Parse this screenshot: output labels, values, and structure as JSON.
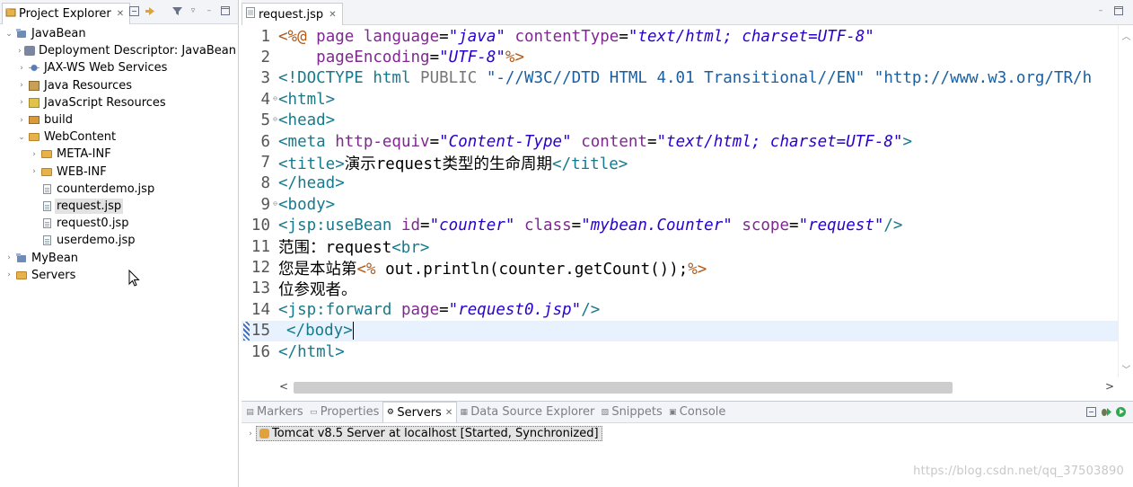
{
  "explorer": {
    "title": "Project Explorer",
    "tree": [
      {
        "label": "JavaBean",
        "depth": 0,
        "twist": "open",
        "icon": "project-icon"
      },
      {
        "label": "Deployment Descriptor: JavaBean",
        "depth": 1,
        "twist": "closed",
        "icon": "deployment-descriptor-icon"
      },
      {
        "label": "JAX-WS Web Services",
        "depth": 1,
        "twist": "closed",
        "icon": "web-services-icon"
      },
      {
        "label": "Java Resources",
        "depth": 1,
        "twist": "closed",
        "icon": "java-resources-icon"
      },
      {
        "label": "JavaScript Resources",
        "depth": 1,
        "twist": "closed",
        "icon": "javascript-resources-icon"
      },
      {
        "label": "build",
        "depth": 1,
        "twist": "closed",
        "icon": "build-folder-icon"
      },
      {
        "label": "WebContent",
        "depth": 1,
        "twist": "open",
        "icon": "folder-icon"
      },
      {
        "label": "META-INF",
        "depth": 2,
        "twist": "closed",
        "icon": "folder-icon"
      },
      {
        "label": "WEB-INF",
        "depth": 2,
        "twist": "closed",
        "icon": "folder-icon"
      },
      {
        "label": "counterdemo.jsp",
        "depth": 2,
        "twist": "none",
        "icon": "jsp-file-icon"
      },
      {
        "label": "request.jsp",
        "depth": 2,
        "twist": "none",
        "icon": "jsp-file-icon",
        "selected": true
      },
      {
        "label": "request0.jsp",
        "depth": 2,
        "twist": "none",
        "icon": "jsp-file-icon"
      },
      {
        "label": "userdemo.jsp",
        "depth": 2,
        "twist": "none",
        "icon": "jsp-file-icon"
      },
      {
        "label": "MyBean",
        "depth": 0,
        "twist": "closed",
        "icon": "project-icon"
      },
      {
        "label": "Servers",
        "depth": 0,
        "twist": "closed",
        "icon": "folder-icon"
      }
    ]
  },
  "editor": {
    "tab_label": "request.jsp",
    "current_line": 15,
    "lines": [
      {
        "n": "1",
        "fold": false,
        "tokens": [
          [
            "jsp",
            "<%@ "
          ],
          [
            "attr",
            "page "
          ],
          [
            "attr",
            "language"
          ],
          [
            "txt",
            "="
          ],
          [
            "val",
            "\"java\""
          ],
          [
            "txt",
            " "
          ],
          [
            "attr",
            "contentType"
          ],
          [
            "txt",
            "="
          ],
          [
            "val",
            "\"text/html; charset=UTF-8\""
          ]
        ]
      },
      {
        "n": "2",
        "fold": false,
        "tokens": [
          [
            "txt",
            "    "
          ],
          [
            "attr",
            "pageEncoding"
          ],
          [
            "txt",
            "="
          ],
          [
            "val",
            "\"UTF-8\""
          ],
          [
            "jsp",
            "%>"
          ]
        ]
      },
      {
        "n": "3",
        "fold": false,
        "tokens": [
          [
            "dt",
            "<!DOCTYPE html "
          ],
          [
            "pub",
            "PUBLIC "
          ],
          [
            "str",
            "\"-//W3C//DTD HTML 4.01 Transitional//EN\" \"http://www.w3.org/TR/h"
          ]
        ]
      },
      {
        "n": "4",
        "fold": true,
        "tokens": [
          [
            "tag",
            "<html>"
          ]
        ]
      },
      {
        "n": "5",
        "fold": true,
        "tokens": [
          [
            "tag",
            "<head>"
          ]
        ]
      },
      {
        "n": "6",
        "fold": false,
        "tokens": [
          [
            "tag",
            "<meta "
          ],
          [
            "attr",
            "http-equiv"
          ],
          [
            "txt",
            "="
          ],
          [
            "val",
            "\"Content-Type\""
          ],
          [
            "txt",
            " "
          ],
          [
            "attr",
            "content"
          ],
          [
            "txt",
            "="
          ],
          [
            "val",
            "\"text/html; charset=UTF-8\""
          ],
          [
            "tag",
            ">"
          ]
        ]
      },
      {
        "n": "7",
        "fold": false,
        "tokens": [
          [
            "tag",
            "<title>"
          ],
          [
            "txt",
            "演示request类型的生命周期"
          ],
          [
            "tag",
            "</title>"
          ]
        ]
      },
      {
        "n": "8",
        "fold": false,
        "tokens": [
          [
            "tag",
            "</head>"
          ]
        ]
      },
      {
        "n": "9",
        "fold": true,
        "tokens": [
          [
            "tag",
            "<body>"
          ]
        ]
      },
      {
        "n": "10",
        "fold": false,
        "tokens": [
          [
            "tag",
            "<jsp:useBean "
          ],
          [
            "attr",
            "id"
          ],
          [
            "txt",
            "="
          ],
          [
            "val",
            "\"counter\""
          ],
          [
            "txt",
            " "
          ],
          [
            "attr",
            "class"
          ],
          [
            "txt",
            "="
          ],
          [
            "val",
            "\"mybean.Counter\""
          ],
          [
            "txt",
            " "
          ],
          [
            "attr",
            "scope"
          ],
          [
            "txt",
            "="
          ],
          [
            "val",
            "\"request\""
          ],
          [
            "tag",
            "/>"
          ]
        ]
      },
      {
        "n": "11",
        "fold": false,
        "tokens": [
          [
            "txt",
            "范围：request"
          ],
          [
            "tag",
            "<br>"
          ]
        ]
      },
      {
        "n": "12",
        "fold": false,
        "tokens": [
          [
            "txt",
            "您是本站第"
          ],
          [
            "jsp",
            "<%"
          ],
          [
            "txt",
            " out.println(counter.getCount());"
          ],
          [
            "jsp",
            "%>"
          ]
        ]
      },
      {
        "n": "13",
        "fold": false,
        "tokens": [
          [
            "txt",
            "位参观者。"
          ]
        ]
      },
      {
        "n": "14",
        "fold": false,
        "tokens": [
          [
            "tag",
            "<jsp:forward "
          ],
          [
            "attr",
            "page"
          ],
          [
            "txt",
            "="
          ],
          [
            "val",
            "\"request0.jsp\""
          ],
          [
            "tag",
            "/>"
          ]
        ]
      },
      {
        "n": "15",
        "fold": false,
        "tokens": [
          [
            "tag",
            "</body>"
          ]
        ]
      },
      {
        "n": "16",
        "fold": false,
        "tokens": [
          [
            "tag",
            "</html>"
          ]
        ]
      }
    ]
  },
  "bottom": {
    "tabs": [
      {
        "label": "Markers",
        "icon": "markers-icon",
        "active": false
      },
      {
        "label": "Properties",
        "icon": "properties-icon",
        "active": false
      },
      {
        "label": "Servers",
        "icon": "servers-icon",
        "active": true
      },
      {
        "label": "Data Source Explorer",
        "icon": "data-source-icon",
        "active": false
      },
      {
        "label": "Snippets",
        "icon": "snippets-icon",
        "active": false
      },
      {
        "label": "Console",
        "icon": "console-icon",
        "active": false
      }
    ],
    "server_entry": "Tomcat v8.5 Server at localhost  [Started, Synchronized]"
  },
  "watermark": "https://blog.csdn.net/qq_37503890"
}
